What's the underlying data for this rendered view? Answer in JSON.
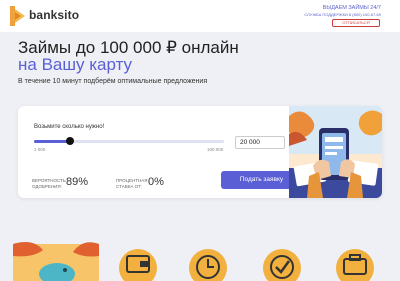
{
  "header": {
    "logo_text": "banksito",
    "line1": "ВЫДАЕМ ЗАЙМЫ 24/7",
    "line2": "СЛУЖБА ПОДДЕРЖКИ 8 (800) 100-67-69",
    "unsubscribe_label": "ОТПИСАТЬСЯ"
  },
  "hero": {
    "title_line1": "Займы до 100 000 ₽ онлайн",
    "title_line2": "на Вашу карту",
    "subtitle": "В течение 10 минут подберём оптимальные предложения"
  },
  "form": {
    "question": "Возьмите сколько нужно!",
    "slider_min_label": "1 000",
    "slider_max_label": "100 000",
    "slider_fraction": 0.19,
    "amount_value": "20 000",
    "approval_label": "ВЕРОЯТНОСТЬ ОДОБРЕНИЯ:",
    "approval_value": "89%",
    "rate_label": "ПРОЦЕНТНАЯ СТАВКА ОТ:",
    "rate_value": "0%",
    "submit_label": "Подать заявку"
  },
  "colors": {
    "accent": "#5a5fd6",
    "logo_orange": "#f0a13a",
    "warning_red": "#cf3a3a"
  },
  "features": {
    "icons": [
      "piggy-bank-icon",
      "wallet-icon",
      "clock-icon",
      "checkmark-icon",
      "briefcase-icon"
    ]
  }
}
